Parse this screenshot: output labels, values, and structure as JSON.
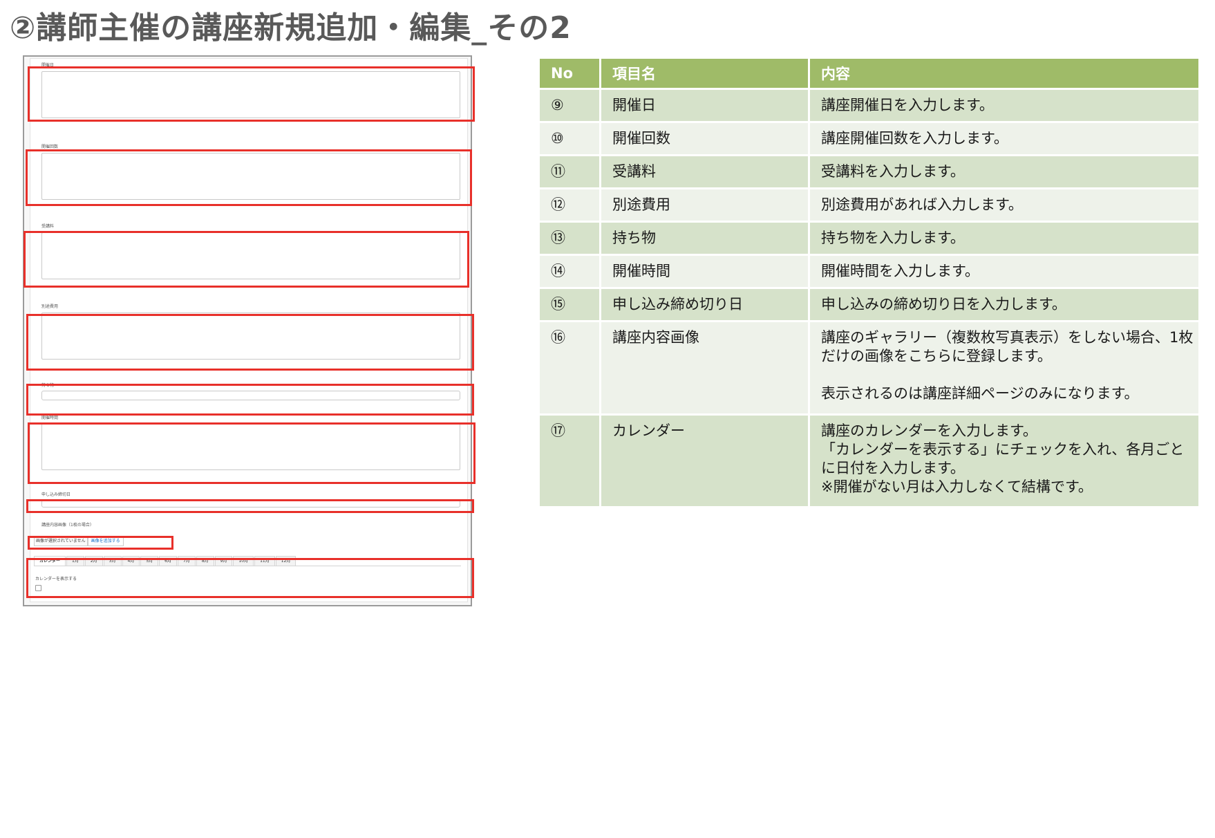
{
  "page_title": "②講師主催の講座新規追加・編集_その2",
  "form": {
    "field_labels": [
      "開催日",
      "開催回数",
      "受講料",
      "別途費用",
      "持ち物",
      "開催時間",
      "申し込み締切日"
    ],
    "image_label": "講座内容画像（1枚の場合）",
    "image_status": "画像が選択されていません",
    "image_add_button": "画像を追加する",
    "calendar_tabs": [
      "カレンダー",
      "1月",
      "2月",
      "3月",
      "4月",
      "5月",
      "6月",
      "7月",
      "8月",
      "9月",
      "10月",
      "11月",
      "12月"
    ],
    "calendar_show_label": "カレンダーを表示する",
    "highlight_color": "#e8302a"
  },
  "table": {
    "headers": [
      "No",
      "項目名",
      "内容"
    ],
    "header_color": "#9fbb68",
    "rows": [
      {
        "no": "⑨",
        "name": "開催日",
        "desc": [
          "講座開催日を入力します。"
        ]
      },
      {
        "no": "⑩",
        "name": "開催回数",
        "desc": [
          "講座開催回数を入力します。"
        ]
      },
      {
        "no": "⑪",
        "name": "受講料",
        "desc": [
          "受講料を入力します。"
        ]
      },
      {
        "no": "⑫",
        "name": "別途費用",
        "desc": [
          "別途費用があれば入力します。"
        ]
      },
      {
        "no": "⑬",
        "name": "持ち物",
        "desc": [
          "持ち物を入力します。"
        ]
      },
      {
        "no": "⑭",
        "name": "開催時間",
        "desc": [
          "開催時間を入力します。"
        ]
      },
      {
        "no": "⑮",
        "name": "申し込み締め切り日",
        "desc": [
          "申し込みの締め切り日を入力します。"
        ]
      },
      {
        "no": "⑯",
        "name": "講座内容画像",
        "desc": [
          "講座のギャラリー（複数枚写真表示）をしない場合、1枚だけの画像をこちらに登録します。",
          "",
          "表示されるのは講座詳細ページのみになります。"
        ]
      },
      {
        "no": "⑰",
        "name": "カレンダー",
        "desc": [
          "講座のカレンダーを入力します。",
          "「カレンダーを表示する」にチェックを入れ、各月ごとに日付を入力します。",
          "※開催がない月は入力しなくて結構です。"
        ]
      }
    ]
  }
}
